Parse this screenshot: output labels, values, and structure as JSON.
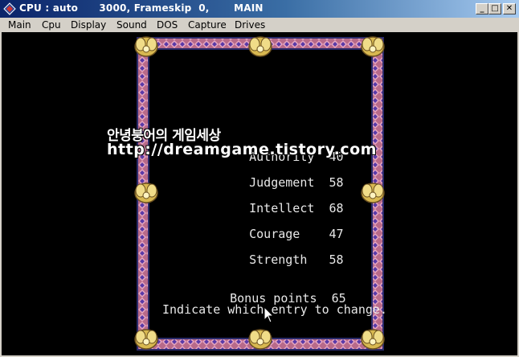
{
  "window": {
    "title": "CPU : auto      3000, Frameskip  0,       MAIN",
    "min_glyph": "_",
    "max_glyph": "□",
    "close_glyph": "✕"
  },
  "menu": {
    "items": [
      "Main",
      "Cpu",
      "Display",
      "Sound",
      "DOS",
      "Capture",
      "Drives"
    ]
  },
  "watermark": {
    "line1": "안녕붕어의 게임세상",
    "line2": "http://dreamgame.tistory.com"
  },
  "game": {
    "stats": [
      {
        "label": "Authority",
        "value": "40"
      },
      {
        "label": "Judgement",
        "value": "58"
      },
      {
        "label": "Intellect",
        "value": "68"
      },
      {
        "label": "Courage",
        "value": "47"
      },
      {
        "label": "Strength",
        "value": "58"
      }
    ],
    "bonus": {
      "label": "Bonus points",
      "value": "65"
    },
    "prompt": "Indicate which entry to change."
  },
  "colors": {
    "border_pink": "#c87a9a",
    "border_blue": "#4a3a9a",
    "ornament_gold": "#e8d070",
    "text": "#e8e8e8"
  }
}
